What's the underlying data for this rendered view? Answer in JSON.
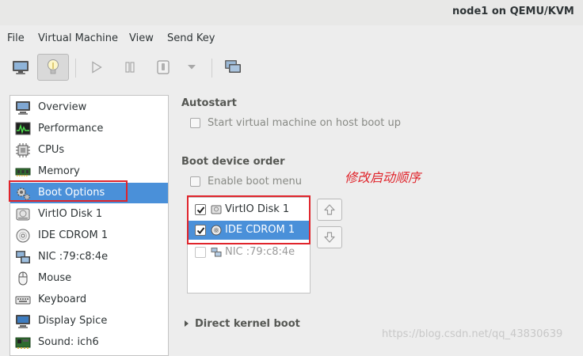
{
  "window": {
    "title": "node1 on QEMU/KVM"
  },
  "menu": [
    "File",
    "Virtual Machine",
    "View",
    "Send Key"
  ],
  "toolbar": {
    "buttons": [
      {
        "name": "console-button",
        "icon": "monitor-icon"
      },
      {
        "name": "details-button",
        "icon": "lightbulb-icon",
        "active": true
      },
      {
        "name": "run-button",
        "icon": "play-icon"
      },
      {
        "name": "pause-button",
        "icon": "pause-icon"
      },
      {
        "name": "shutdown-button",
        "icon": "power-icon"
      },
      {
        "name": "shutdown-menu-button",
        "icon": "chevron-down-icon"
      },
      {
        "name": "fullscreen-button",
        "icon": "screens-icon"
      }
    ]
  },
  "sidebar": {
    "items": [
      {
        "label": "Overview",
        "icon": "overview-icon"
      },
      {
        "label": "Performance",
        "icon": "performance-icon"
      },
      {
        "label": "CPUs",
        "icon": "cpu-icon"
      },
      {
        "label": "Memory",
        "icon": "memory-icon"
      },
      {
        "label": "Boot Options",
        "icon": "boot-options-icon",
        "selected": true
      },
      {
        "label": "VirtIO Disk 1",
        "icon": "disk-icon"
      },
      {
        "label": "IDE CDROM 1",
        "icon": "cdrom-icon"
      },
      {
        "label": "NIC :79:c8:4e",
        "icon": "nic-icon"
      },
      {
        "label": "Mouse",
        "icon": "mouse-icon"
      },
      {
        "label": "Keyboard",
        "icon": "keyboard-icon"
      },
      {
        "label": "Display Spice",
        "icon": "display-icon"
      },
      {
        "label": "Sound: ich6",
        "icon": "sound-icon"
      }
    ]
  },
  "autostart": {
    "heading": "Autostart",
    "option": "Start virtual machine on host boot up",
    "checked": false
  },
  "boot": {
    "heading": "Boot device order",
    "enable_menu": "Enable boot menu",
    "enable_menu_checked": false,
    "devices": [
      {
        "label": "VirtIO Disk 1",
        "checked": true,
        "selected": false,
        "icon": "disk-icon"
      },
      {
        "label": "IDE CDROM 1",
        "checked": true,
        "selected": true,
        "icon": "cdrom-icon"
      },
      {
        "label": "NIC :79:c8:4e",
        "checked": false,
        "selected": false,
        "disabled": true,
        "icon": "nic-icon"
      }
    ]
  },
  "annotation": "修改启动顺序",
  "direct_kernel": "Direct kernel boot",
  "watermark": "https://blog.csdn.net/qq_43830639",
  "colors": {
    "selection": "#4a90d9",
    "annotation": "#e0242b"
  }
}
